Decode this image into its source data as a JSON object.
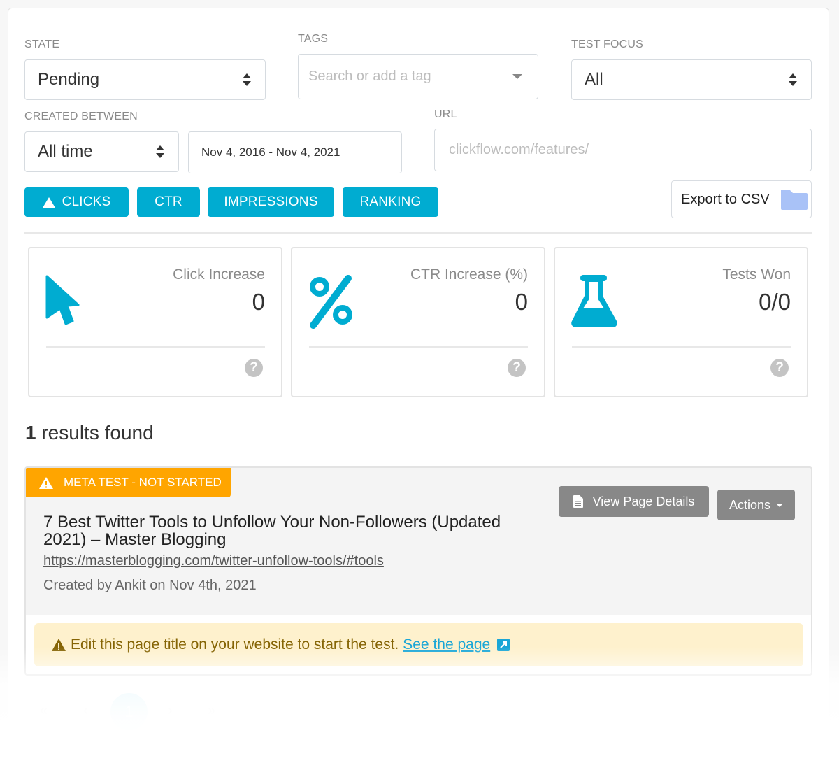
{
  "filters": {
    "state": {
      "label": "STATE",
      "value": "Pending"
    },
    "tags": {
      "label": "TAGS",
      "placeholder": "Search or add a tag"
    },
    "test_focus": {
      "label": "TEST FOCUS",
      "value": "All"
    },
    "created_between": {
      "label": "CREATED BETWEEN",
      "range_value": "All time",
      "date_range": "Nov 4, 2016 - Nov 4, 2021"
    },
    "url": {
      "label": "URL",
      "placeholder": "clickflow.com/features/"
    }
  },
  "metric_buttons": [
    {
      "label": "CLICKS",
      "sorted": true,
      "icon": "triangle-up-icon"
    },
    {
      "label": "CTR"
    },
    {
      "label": "IMPRESSIONS"
    },
    {
      "label": "RANKING"
    }
  ],
  "export": {
    "label": "Export to CSV",
    "icon": "folder-icon"
  },
  "stats": [
    {
      "title": "Click Increase",
      "value": "0",
      "icon": "cursor-icon"
    },
    {
      "title": "CTR Increase (%)",
      "value": "0",
      "icon": "percent-icon"
    },
    {
      "title": "Tests Won",
      "value": "0/0",
      "icon": "flask-icon"
    }
  ],
  "colors": {
    "accent": "#00acd1",
    "warning": "#ffa500",
    "folder": "#a9c2f7"
  },
  "results": {
    "count": "1",
    "count_suffix": " results found",
    "items": [
      {
        "badge": "META TEST - NOT STARTED",
        "title": "7 Best Twitter Tools to Unfollow Your Non-Followers (Updated 2021) – Master Blogging",
        "url": "https://masterblogging.com/twitter-unfollow-tools/#tools",
        "created": "Created by Ankit on Nov 4th, 2021",
        "view_details_label": "View Page Details",
        "actions_label": "Actions",
        "notice_text": "Edit this page title on your website to start the test.",
        "notice_link": "See the page"
      }
    ]
  },
  "pagination": {
    "first": "«",
    "prev": "‹",
    "current": "1",
    "next": "›",
    "last": "»"
  }
}
